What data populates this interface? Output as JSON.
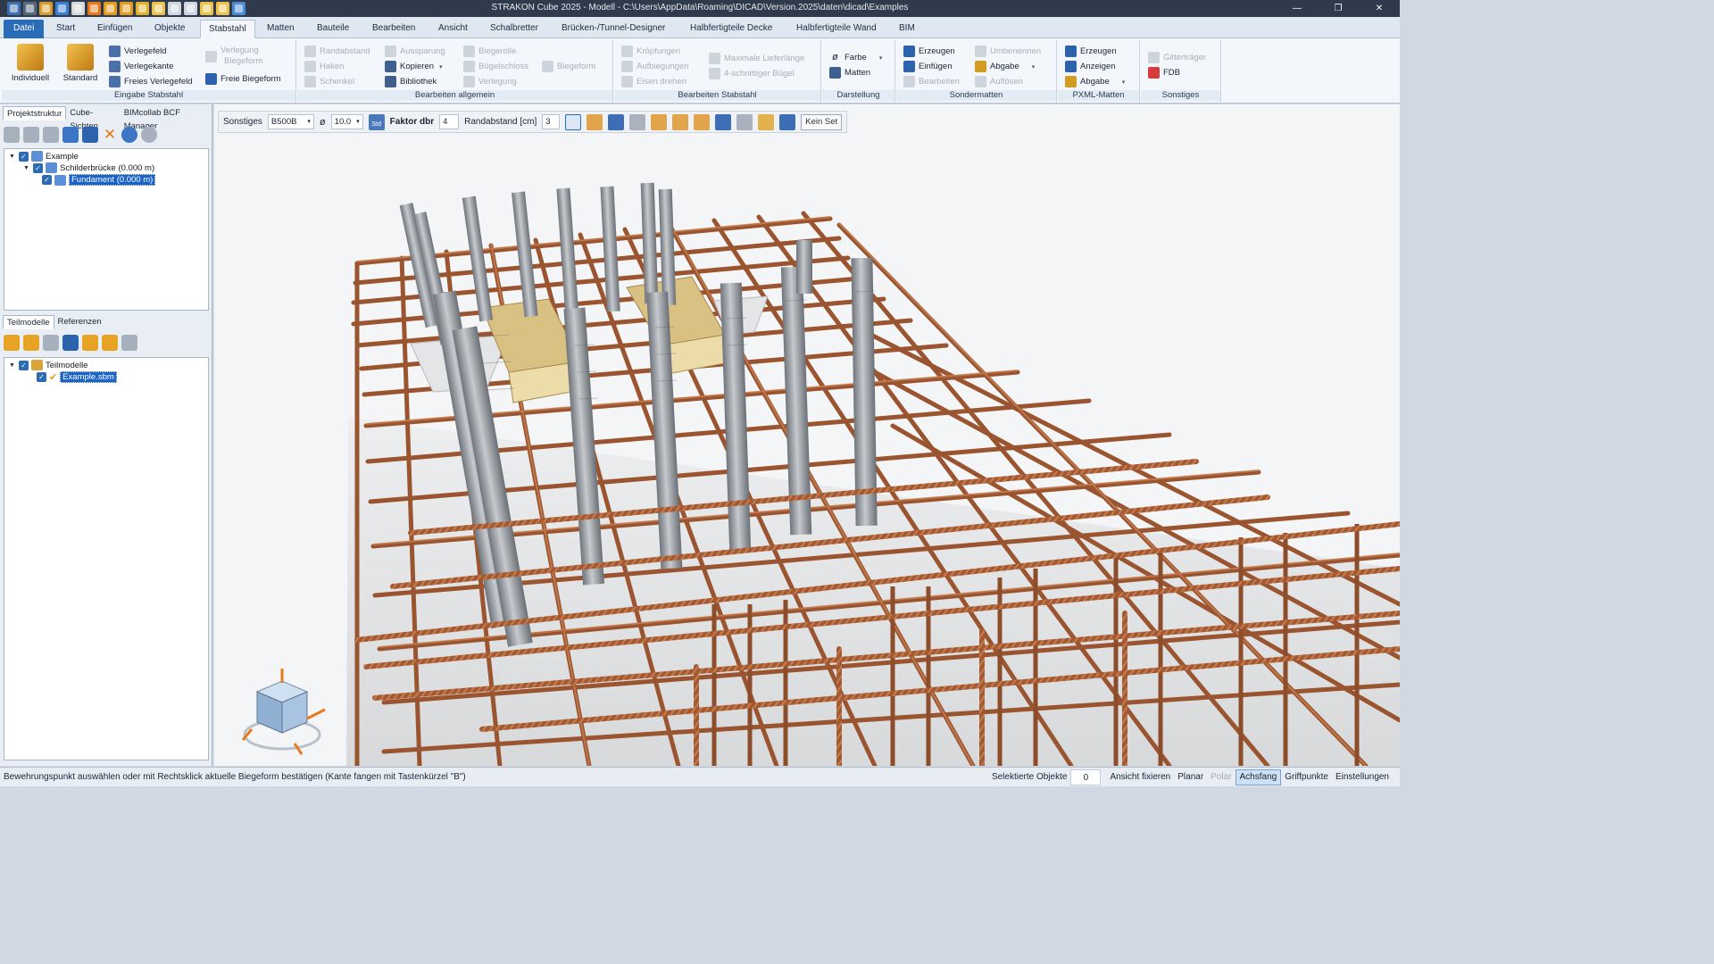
{
  "window": {
    "title": "STRAKON Cube 2025 - Modell - C:\\Users\\AppData\\Roaming\\DICAD\\Version.2025\\daten\\dicad\\Examples",
    "minimize": "—",
    "maximize": "❐",
    "close": "✕"
  },
  "menu": {
    "tabs": [
      "Datei",
      "Start",
      "Einfügen",
      "Objekte",
      "Stabstahl",
      "Matten",
      "Bauteile",
      "Bearbeiten",
      "Ansicht",
      "Schalbretter",
      "Brücken-/Tunnel-Designer",
      "Halbfertigteile Decke",
      "Halbfertigteile Wand",
      "BIM"
    ],
    "active": "Stabstahl"
  },
  "ribbon": {
    "eingabe": {
      "label": "Eingabe Stabstahl",
      "individuell": "Individuell",
      "standard": "Standard",
      "verlegefeld": "Verlegefeld",
      "verlegekante": "Verlegekante",
      "freies_verlegefeld": "Freies Verlegefeld",
      "verlegung_biegeform_1": "Verlegung",
      "verlegung_biegeform_2": "Biegeform",
      "freie_biegeform": "Freie Biegeform"
    },
    "bearbeiten_allgemein": {
      "label": "Bearbeiten allgemein",
      "randabstand": "Randabstand",
      "haken": "Haken",
      "schenkel": "Schenkel",
      "aussparung": "Aussparung",
      "kopieren": "Kopieren",
      "bibliothek": "Bibliothek",
      "biegerolle": "Biegerolle",
      "buegelschloss": "Bügelschloss",
      "verlegung": "Verlegung",
      "biegeform": "Biegeform"
    },
    "bearbeiten_stabstahl": {
      "label": "Bearbeiten Stabstahl",
      "kroepfungen": "Kröpfungen",
      "aufbiegungen": "Aufbiegungen",
      "eisen_drehen": "Eisen drehen",
      "maximale_lieferlaenge": "Maximale Lieferlänge",
      "vierschnittiger_buegel": "4-schnittiger Bügel"
    },
    "darstellung": {
      "label": "Darstellung",
      "farbe": "Farbe",
      "matten": "Matten"
    },
    "sondermatten": {
      "label": "Sondermatten",
      "erzeugen": "Erzeugen",
      "einfuegen": "Einfügen",
      "bearbeiten": "Bearbeiten",
      "umbenennen": "Umbenennen",
      "abgabe": "Abgabe",
      "aufloesen": "Auflösen"
    },
    "pxml": {
      "label": "PXML-Matten",
      "erzeugen": "Erzeugen",
      "anzeigen": "Anzeigen",
      "abgabe": "Abgabe"
    },
    "sonstiges": {
      "label": "Sonstiges",
      "gittertraeger": "Gitterträger",
      "fdb": "FDB"
    }
  },
  "left_panel": {
    "top_tabs": [
      "Projektstruktur",
      "Cube-Sichten",
      "BIMcollab BCF Manager"
    ],
    "tree": [
      {
        "label": "Example"
      },
      {
        "label": "Schilderbrücke (0.000 m)"
      },
      {
        "label": "Fundament (0.000 m)"
      }
    ],
    "bottom_tabs": [
      "Teilmodelle",
      "Referenzen"
    ],
    "tree2": [
      {
        "label": "Teilmodelle"
      },
      {
        "label": "Example.sbm"
      }
    ]
  },
  "options_bar": {
    "sonstiges_label": "Sonstiges",
    "grade": "B500B",
    "diameter_symbol": "ø",
    "diameter": "10.0",
    "std_label": "Std",
    "faktor_label": "Faktor dbr",
    "faktor_value": "4",
    "randabstand_label": "Randabstand [cm]",
    "randabstand_value": "3",
    "kein_set": "Kein Set"
  },
  "status": {
    "message": "Bewehrungspunkt auswählen oder mit Rechtsklick aktuelle Biegeform bestätigen (Kante fangen mit Tastenkürzel \"B\")",
    "selektierte_objekte": "Selektierte Objekte",
    "count": "0",
    "ansicht_fixieren": "Ansicht fixieren",
    "planar": "Planar",
    "polar": "Polar",
    "achsfang": "Achsfang",
    "griffpunkte": "Griffpunkte",
    "einstellungen": "Einstellungen"
  },
  "colors": {
    "accent": "#2b6cb9",
    "rebar": "#a8603a",
    "anchor": "#9ea3a8",
    "formwork": "#e8d4a0"
  }
}
